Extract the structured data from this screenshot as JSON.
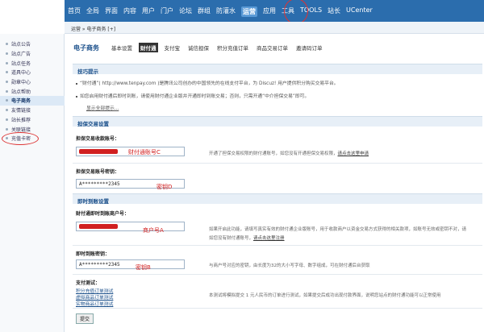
{
  "topnav": {
    "items": [
      "首页",
      "全局",
      "界面",
      "内容",
      "用户",
      "门户",
      "论坛",
      "群组",
      "防灌水",
      "运营",
      "应用",
      "工具",
      "TOOLS",
      "站长",
      "UCenter"
    ],
    "active_index": 9
  },
  "breadcrumb": {
    "text": "运营 » 电子商务 [+]"
  },
  "sidebar": {
    "items": [
      "站点公告",
      "站点广告",
      "站点任务",
      "道具中心",
      "勋章中心",
      "站点帮助",
      "电子商务",
      "友情链接",
      "站长推荐",
      "关联链接",
      "充值卡密"
    ],
    "active_index": 6
  },
  "main": {
    "title": "电子商务",
    "tabs": [
      "基本设置",
      "财付通",
      "支付宝",
      "诚信担保",
      "积分充值订单",
      "商品交易订单",
      "邀请码订单"
    ],
    "active_tab": 1
  },
  "tips": {
    "heading": "技巧提示",
    "line1": "“财付通”( http://www.tenpay.com )是腾讯公司创办的中国领先的在线支付平台，为 Discuz! 用户提供积分购买交易平台。",
    "line2": "如您启用财付通后即时到账，请使用财付通企业版并开通即时到账交易；否则，只需开通“中介担保交易”即可。",
    "toggle": "显示全部提示..."
  },
  "guarantee": {
    "heading": "担保交易设置",
    "account_label": "担保交易收款账号：",
    "account_hint": "开通了担保交易权限的财付通账号，如您没有开通担保交易权限，",
    "account_hint_link": "请点击这里申请",
    "account_annotation": "财付通账号C",
    "key_label": "担保交易账号密钥：",
    "key_value": "A*********2345",
    "key_annotation": "密钥D"
  },
  "instant": {
    "heading": "即时到账设置",
    "merchant_label": "财付通即时到账商户号：",
    "merchant_hint_1": "如果开启此功能，请填写真实有效的财付通企业版账号，用于收款商户以资金交易方式获得的相关款项，如账号无效或密钥不对，请",
    "merchant_hint_2": "如您没有财付通账号，",
    "merchant_hint_link": "请点击这里注册",
    "merchant_annotation": "商户号A",
    "key_label": "即时到账密钥：",
    "key_value": "A*********2345",
    "key_hint": "与商户号对应的密钥，由长度为32的大小写字母、数字组成，可在财付通后台获取",
    "key_annotation": "密钥B"
  },
  "test": {
    "label": "支付测试：",
    "links": [
      "积分充值订单测试",
      "虚拟商品订单测试",
      "实物商品订单测试"
    ],
    "hint": "本测试将模拟提交 1 元人民币的订单进行测试，如果提交后成功出现付款界面，说明您站点的财付通功能可以正常使用"
  },
  "submit": {
    "label": "提交"
  }
}
